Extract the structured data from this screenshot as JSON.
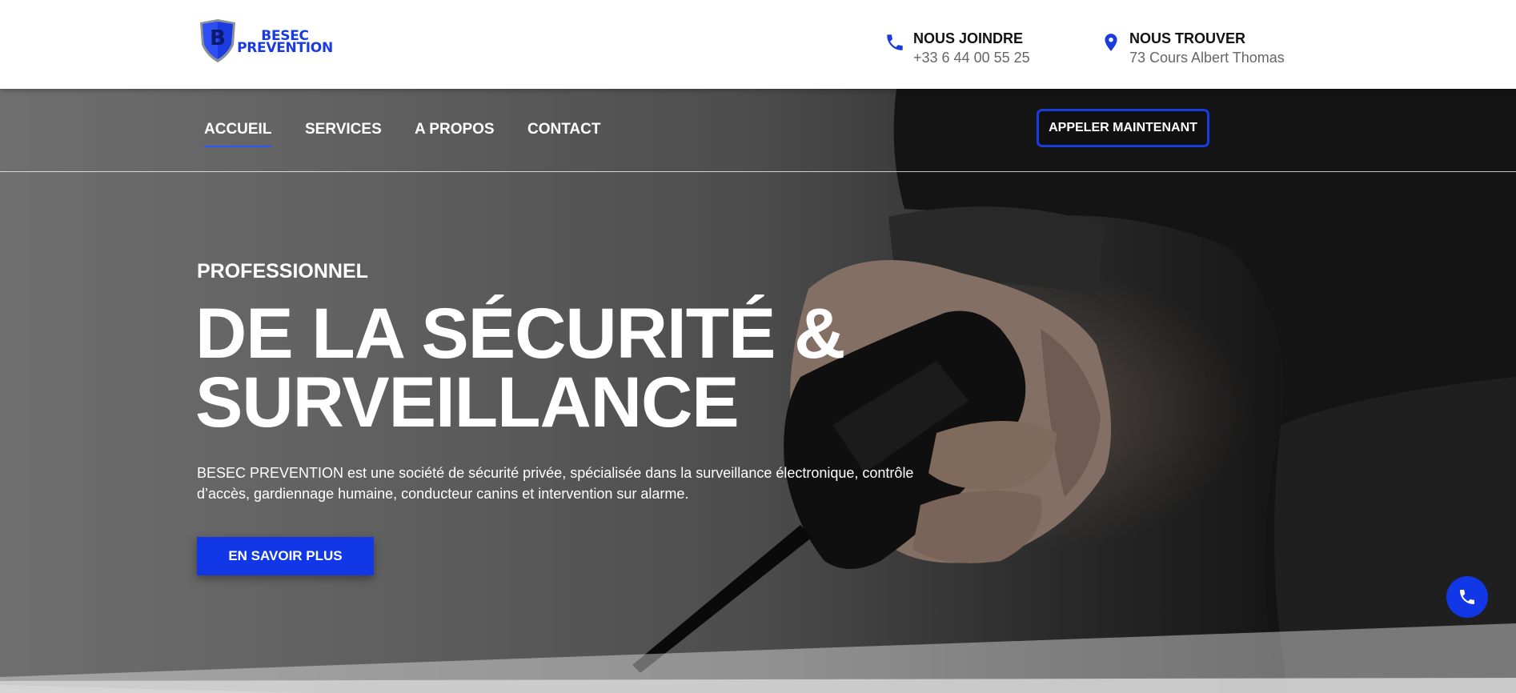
{
  "brand": {
    "logo_line1": "BESEC",
    "logo_line2": "PREVENTION",
    "logo_letter": "B",
    "accent_color": "#1237e6"
  },
  "header": {
    "call": {
      "icon": "phone-icon",
      "label": "NOUS JOINDRE",
      "value": "+33 6 44 00 55 25"
    },
    "find": {
      "icon": "location-pin-icon",
      "label": "NOUS TROUVER",
      "value": "73 Cours Albert Thomas"
    }
  },
  "nav": {
    "items": [
      {
        "label": "ACCUEIL",
        "active": true
      },
      {
        "label": "SERVICES",
        "active": false
      },
      {
        "label": "A PROPOS",
        "active": false
      },
      {
        "label": "CONTACT",
        "active": false
      }
    ],
    "call_button": "APPELER MAINTENANT"
  },
  "hero": {
    "eyebrow": "PROFESSIONNEL",
    "headline_line1": "DE LA SÉCURITÉ &",
    "headline_line2": "SURVEILLANCE",
    "description": "BESEC PREVENTION est une société de sécurité privée, spécialisée dans la surveillance électronique, contrôle d’accès, gardiennage humaine, conducteur canins et intervention sur alarme.",
    "cta": "EN SAVOIR PLUS",
    "fab_icon": "phone-icon"
  }
}
